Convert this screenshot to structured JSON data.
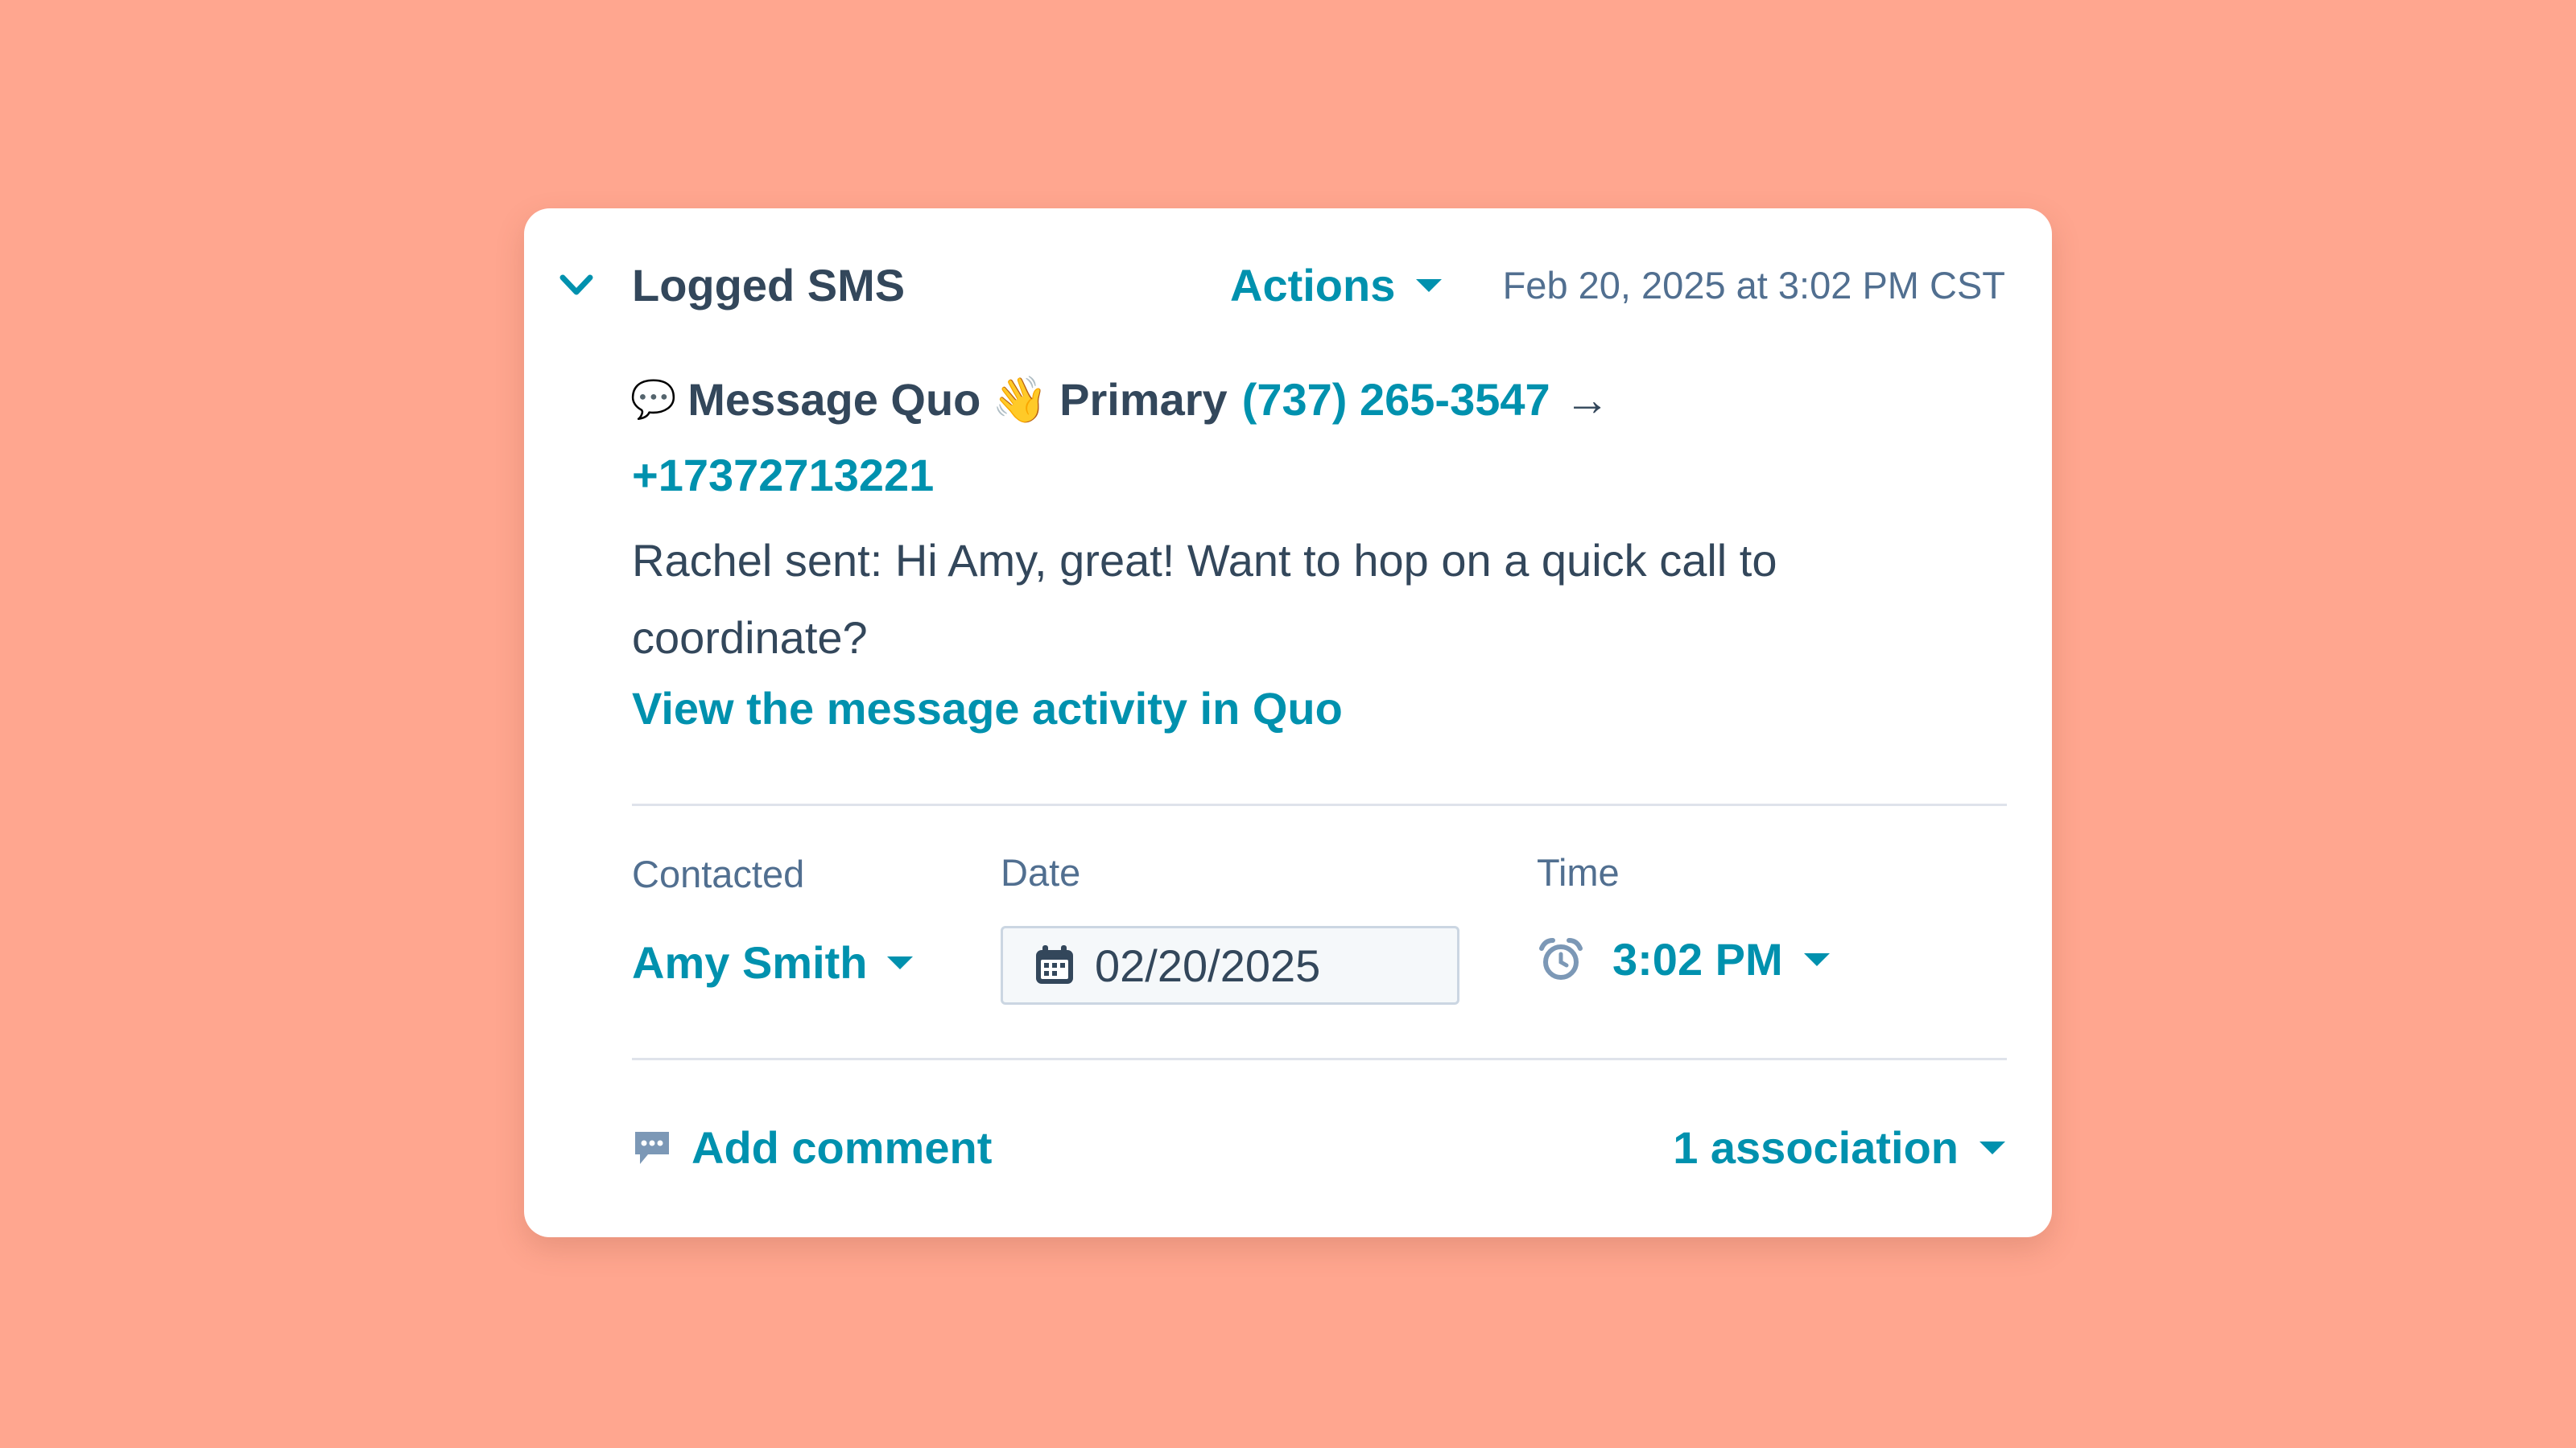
{
  "colors": {
    "background": "#ffa68f",
    "accent": "#0091ae",
    "text": "#33475b",
    "muted": "#516f90"
  },
  "header": {
    "title": "Logged SMS",
    "actions_label": "Actions",
    "timestamp": "Feb 20, 2025 at 3:02 PM CST",
    "collapse_icon": "chevron-down-icon"
  },
  "message": {
    "speech_emoji": "💬",
    "app_name": "Message Quo",
    "wave_emoji": "👋",
    "line_label": "Primary",
    "from_number": "(737) 265-3547",
    "arrow": "→",
    "to_number": "+17372713221",
    "body": "Rachel sent: Hi Amy, great! Want to hop on a quick call to coordinate?",
    "view_link": "View the message activity in Quo"
  },
  "fields": {
    "contacted_label": "Contacted",
    "contacted_value": "Amy Smith",
    "date_label": "Date",
    "date_value": "02/20/2025",
    "time_label": "Time",
    "time_value": "3:02 PM"
  },
  "footer": {
    "add_comment": "Add comment",
    "association": "1 association"
  }
}
